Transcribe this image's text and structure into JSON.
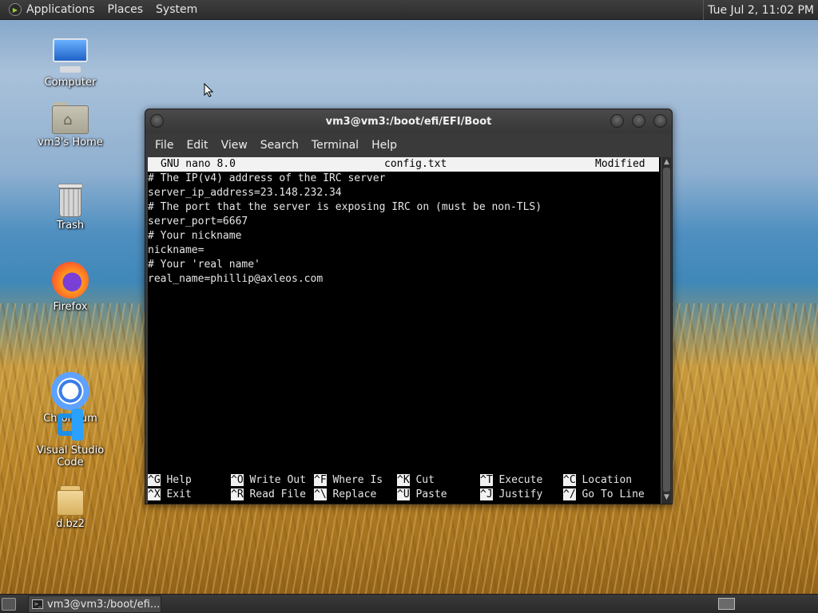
{
  "top_panel": {
    "menus": [
      "Applications",
      "Places",
      "System"
    ],
    "clock": "Tue Jul  2, 11:02 PM"
  },
  "desktop": {
    "icons": [
      {
        "label": "Computer",
        "icon": "computer-icon"
      },
      {
        "label": "vm3's Home",
        "icon": "home-folder-icon"
      },
      {
        "label": "Trash",
        "icon": "trash-icon"
      },
      {
        "label": "Firefox",
        "icon": "firefox-icon"
      },
      {
        "label": "Chromium",
        "icon": "chromium-icon"
      },
      {
        "label": "Visual Studio Code",
        "icon": "vscode-icon"
      },
      {
        "label": "d.bz2",
        "icon": "archive-icon"
      }
    ]
  },
  "window": {
    "title": "vm3@vm3:/boot/efi/EFI/Boot",
    "menu": [
      "File",
      "Edit",
      "View",
      "Search",
      "Terminal",
      "Help"
    ]
  },
  "nano": {
    "version": "GNU nano 8.0",
    "filename": "config.txt",
    "status": "Modified",
    "lines": [
      "# The IP(v4) address of the IRC server",
      "server_ip_address=23.148.232.34",
      "# The port that the server is exposing IRC on (must be non-TLS)",
      "server_port=6667",
      "# Your nickname",
      "nickname=",
      "# Your 'real name'",
      "real_name=phillip@axleos.com"
    ],
    "shortcuts_row1": [
      {
        "key": "^G",
        "label": "Help"
      },
      {
        "key": "^O",
        "label": "Write Out"
      },
      {
        "key": "^F",
        "label": "Where Is"
      },
      {
        "key": "^K",
        "label": "Cut"
      },
      {
        "key": "^T",
        "label": "Execute"
      },
      {
        "key": "^C",
        "label": "Location"
      }
    ],
    "shortcuts_row2": [
      {
        "key": "^X",
        "label": "Exit"
      },
      {
        "key": "^R",
        "label": "Read File"
      },
      {
        "key": "^\\",
        "label": "Replace"
      },
      {
        "key": "^U",
        "label": "Paste"
      },
      {
        "key": "^J",
        "label": "Justify"
      },
      {
        "key": "^/",
        "label": "Go To Line"
      }
    ]
  },
  "taskbar": {
    "task_label": "vm3@vm3:/boot/efi..."
  },
  "colors": {
    "terminal_bg": "#000000",
    "terminal_fg": "#e6e6e6",
    "panel_bg": "#333333"
  }
}
